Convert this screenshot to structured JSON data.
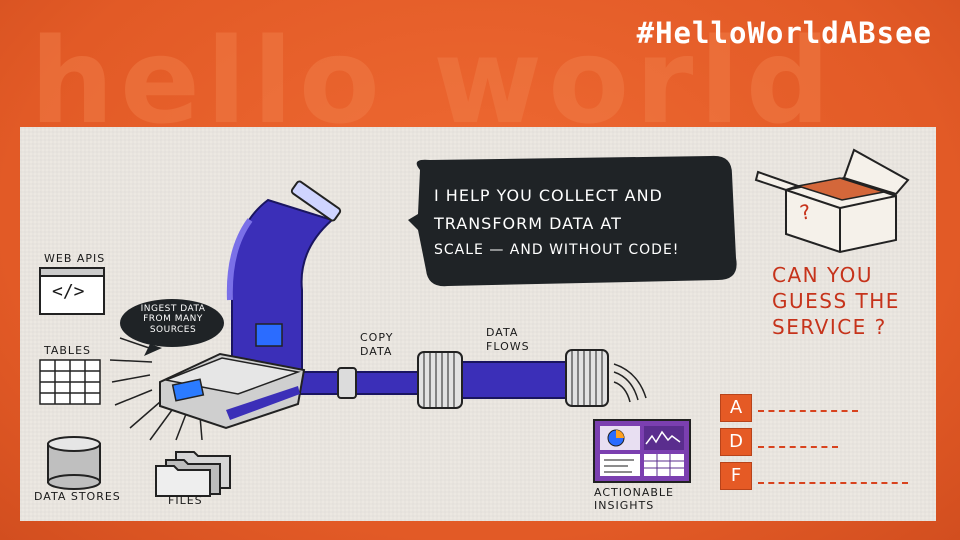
{
  "background_word": "hello world",
  "hashtag": "#HelloWorldABsee",
  "speech_bubble": {
    "line1": "I HELP YOU COLLECT AND",
    "line2": "TRANSFORM DATA AT",
    "line3": "SCALE — AND WITHOUT CODE!"
  },
  "ingest_bubble": {
    "line1": "INGEST DATA",
    "line2": "FROM MANY",
    "line3": "SOURCES"
  },
  "sources": {
    "web_apis": "WEB APIs",
    "tables": "TABLES",
    "data_stores": "DATA STORES",
    "files": "FILES"
  },
  "web_api_symbol": "</>",
  "box_symbol": "?",
  "pipeline": {
    "copy_line1": "COPY",
    "copy_line2": "DATA",
    "flows_line1": "DATA",
    "flows_line2": "FLOWS"
  },
  "insights": {
    "line1": "ACTIONABLE",
    "line2": "INSIGHTS"
  },
  "question": {
    "line1": "CAN YOU",
    "line2": "GUESS THE",
    "line3": "SERVICE ?"
  },
  "answer_letters": [
    "A",
    "D",
    "F"
  ],
  "colors": {
    "orange": "#e8612c",
    "pipe_blue": "#3b2fb8",
    "dark_bubble": "#1f2326",
    "red_text": "#c6331b"
  }
}
